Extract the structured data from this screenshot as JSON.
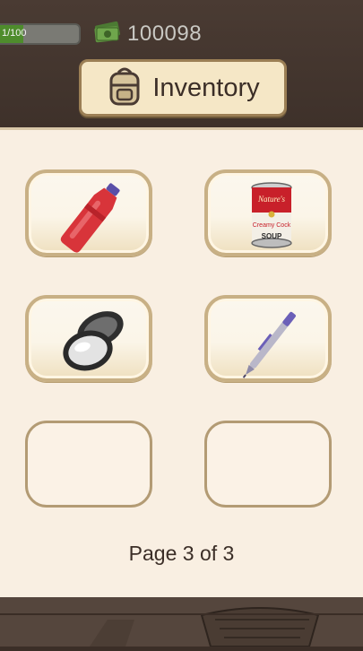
{
  "header": {
    "hp_text": "1/100",
    "hp_fraction": 0.01,
    "money": "100098",
    "money_icon": "cash-stack-icon",
    "title": "Inventory",
    "title_icon": "backpack-icon"
  },
  "inventory": {
    "slots": [
      {
        "item": "soda-bottle-icon",
        "filled": true
      },
      {
        "item": "soup-can-icon",
        "filled": true
      },
      {
        "item": "compact-mirror-icon",
        "filled": true
      },
      {
        "item": "pen-icon",
        "filled": true
      },
      {
        "item": "",
        "filled": false
      },
      {
        "item": "",
        "filled": false
      }
    ],
    "soup_can": {
      "brand": "Nature's",
      "flavor": "Creamy Cock",
      "type": "SOUP"
    }
  },
  "pagination": {
    "label": "Page 3 of 3",
    "current": 3,
    "total": 3
  },
  "colors": {
    "panel": "#f9efe2",
    "title_bg": "#f5e7c6",
    "slot_border": "#c8b085"
  }
}
